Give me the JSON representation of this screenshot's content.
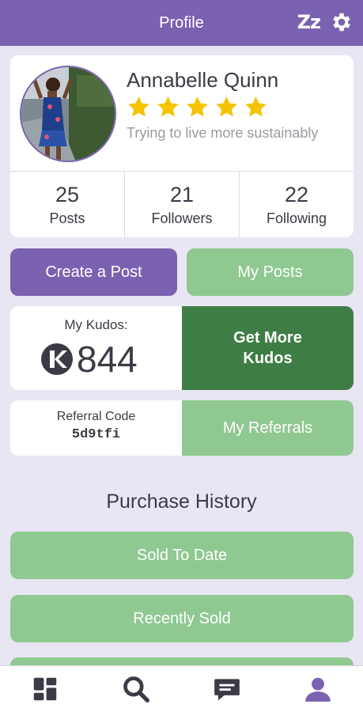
{
  "header": {
    "title": "Profile",
    "snooze_icon_text": "Zz"
  },
  "profile": {
    "name": "Annabelle Quinn",
    "rating": 5,
    "bio": "Trying to live more sustainably",
    "stats": [
      {
        "count": "25",
        "label": "Posts"
      },
      {
        "count": "21",
        "label": "Followers"
      },
      {
        "count": "22",
        "label": "Following"
      }
    ]
  },
  "actions": {
    "create_post": "Create a Post",
    "my_posts": "My Posts"
  },
  "kudos": {
    "label": "My Kudos:",
    "value": "844",
    "get_more": "Get More Kudos"
  },
  "referral": {
    "label": "Referral Code",
    "code": "5d9tfi",
    "my_referrals": "My Referrals"
  },
  "purchase_history": {
    "title": "Purchase History",
    "buttons": [
      "Sold To Date",
      "Recently Sold",
      ""
    ]
  },
  "tabbar": {
    "items": [
      "dashboard-icon",
      "search-icon",
      "messages-icon",
      "profile-icon"
    ],
    "active": "profile-icon"
  },
  "colors": {
    "primary_purple": "#7a62b0",
    "light_green": "#8fc991",
    "dark_green": "#3f7d46",
    "background": "#e8e6f3",
    "star_yellow": "#f5c400"
  }
}
